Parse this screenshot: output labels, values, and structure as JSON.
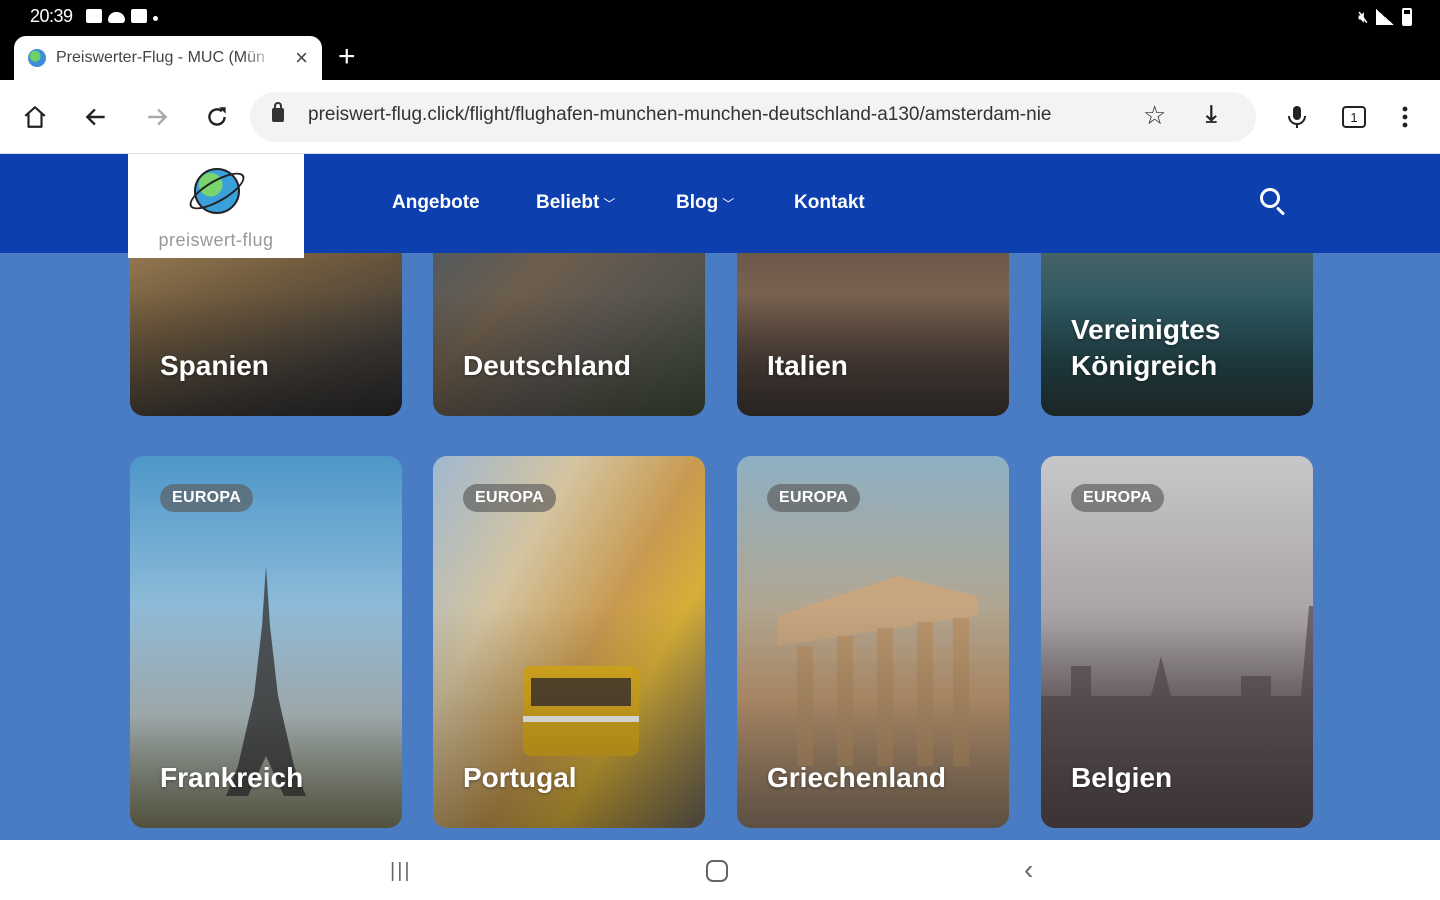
{
  "status_bar": {
    "time": "20:39"
  },
  "browser": {
    "tab_title": "Preiswerter-Flug - MUC (Mün",
    "tab_close": "×",
    "new_tab": "+",
    "url": "preiswert-flug.click/flight/flughafen-munchen-munchen-deutschland-a130/amsterdam-nie",
    "tab_count": "1"
  },
  "site": {
    "logo_text": "preiswert-flug",
    "nav": [
      {
        "label": "Angebote"
      },
      {
        "label": "Beliebt"
      },
      {
        "label": "Blog"
      },
      {
        "label": "Kontakt"
      }
    ],
    "row1": [
      {
        "name": "Spanien"
      },
      {
        "name": "Deutschland"
      },
      {
        "name": "Italien"
      },
      {
        "name": "Vereinigtes Königreich"
      }
    ],
    "row2": [
      {
        "badge": "EUROPA",
        "name": "Frankreich"
      },
      {
        "badge": "EUROPA",
        "name": "Portugal"
      },
      {
        "badge": "EUROPA",
        "name": "Griechenland"
      },
      {
        "badge": "EUROPA",
        "name": "Belgien"
      }
    ]
  },
  "icons": {
    "home": "home-icon",
    "back": "back-arrow-icon",
    "forward": "forward-arrow-icon",
    "reload": "reload-icon",
    "star": "bookmark-star-icon",
    "download": "download-icon",
    "mic": "microphone-icon",
    "menu": "more-vert-icon",
    "search": "search-icon"
  },
  "colors": {
    "nav_bg": "#0d3fae",
    "page_bg": "#4a7cc4"
  }
}
